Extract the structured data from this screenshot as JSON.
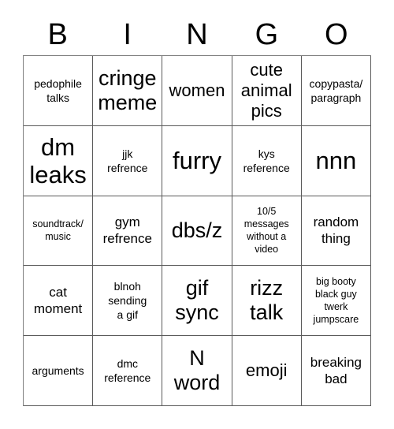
{
  "card": {
    "header_letters": [
      "B",
      "I",
      "N",
      "G",
      "O"
    ],
    "rows": [
      [
        {
          "text": "pedophile\ntalks",
          "size": "fs-xs"
        },
        {
          "text": "cringe\nmeme",
          "size": "fs-lg"
        },
        {
          "text": "women",
          "size": "fs-md"
        },
        {
          "text": "cute\nanimal\npics",
          "size": "fs-md"
        },
        {
          "text": "copypasta/\nparagraph",
          "size": "fs-xs"
        }
      ],
      [
        {
          "text": "dm\nleaks",
          "size": "fs-xl"
        },
        {
          "text": "jjk\nrefrence",
          "size": "fs-xs"
        },
        {
          "text": "furry",
          "size": "fs-xl"
        },
        {
          "text": "kys\nreference",
          "size": "fs-xs"
        },
        {
          "text": "nnn",
          "size": "fs-xl"
        }
      ],
      [
        {
          "text": "soundtrack/\nmusic",
          "size": "fs-xxs"
        },
        {
          "text": "gym\nrefrence",
          "size": "fs-sm"
        },
        {
          "text": "dbs/z",
          "size": "fs-lg"
        },
        {
          "text": "10/5\nmessages\nwithout a\nvideo",
          "size": "fs-xxs"
        },
        {
          "text": "random\nthing",
          "size": "fs-sm"
        }
      ],
      [
        {
          "text": "cat\nmoment",
          "size": "fs-sm"
        },
        {
          "text": "blnoh\nsending\na gif",
          "size": "fs-xs"
        },
        {
          "text": "gif\nsync",
          "size": "fs-lg"
        },
        {
          "text": "rizz\ntalk",
          "size": "fs-lg"
        },
        {
          "text": "big booty\nblack guy\ntwerk\njumpscare",
          "size": "fs-xxs"
        }
      ],
      [
        {
          "text": "arguments",
          "size": "fs-xs"
        },
        {
          "text": "dmc\nreference",
          "size": "fs-xs"
        },
        {
          "text": "N\nword",
          "size": "fs-lg"
        },
        {
          "text": "emoji",
          "size": "fs-md"
        },
        {
          "text": "breaking\nbad",
          "size": "fs-sm"
        }
      ]
    ]
  },
  "colors": {
    "background": "#ffffff",
    "text": "#000000",
    "cell_border": "#5a5a5a",
    "grid_outer_border": "#808080"
  }
}
